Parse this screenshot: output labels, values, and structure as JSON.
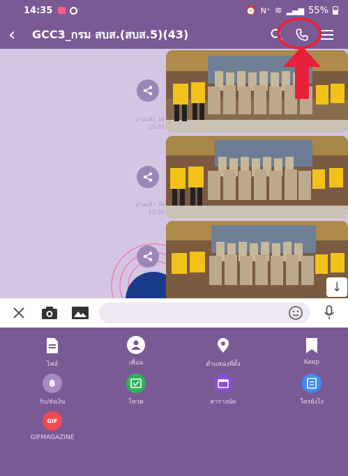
{
  "status_bar": {
    "time": "14:35",
    "battery": "55%"
  },
  "header": {
    "title": "GCC3_กรม สบส.(สบส.5)(43)"
  },
  "chat": {
    "messages": [
      {
        "meta": "อ่านแล้ว 34\n15:03"
      },
      {
        "meta": "อ่านแล้ว 34\n15:03"
      },
      {
        "meta": ""
      }
    ]
  },
  "input": {
    "value": "",
    "placeholder": ""
  },
  "attachment_panel": {
    "items": [
      {
        "label": "ไฟล์",
        "icon": "file-icon",
        "color": "#ffffff"
      },
      {
        "label": "เพื่อน",
        "icon": "friend-icon",
        "color": "#ffffff"
      },
      {
        "label": "ตำแหน่งที่ตั้ง",
        "icon": "location-icon",
        "color": "#ffffff"
      },
      {
        "label": "Keep",
        "icon": "bookmark-icon",
        "color": "#ffffff"
      },
      {
        "label": "รับ/ส่งเงิน",
        "icon": "money-icon",
        "color": "#a78bc2"
      },
      {
        "label": "โหวต",
        "icon": "vote-icon",
        "color": "#2bb45a"
      },
      {
        "label": "ตารางนัด",
        "icon": "calendar-icon",
        "color": "#8a4fd8"
      },
      {
        "label": "ใครยังไง",
        "icon": "ghost-list-icon",
        "color": "#3f8cf5"
      },
      {
        "label": "GIFMAGAZINE",
        "icon": "gif-icon",
        "color": "#f04a55",
        "badge": "GIF"
      }
    ]
  },
  "colors": {
    "header": "#7a5a95",
    "chat_bg": "#d4c6e2",
    "annotation": "#e8213a"
  }
}
